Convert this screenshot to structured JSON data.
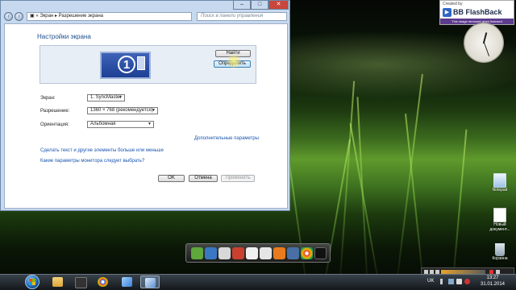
{
  "window": {
    "title": "",
    "breadcrumb_parts": [
      "Экран",
      "Разрешение экрана"
    ],
    "search_placeholder": "Поиск в панели управления",
    "page_title": "Настройки экрана",
    "buttons": {
      "find": "Найти",
      "identify": "Определить",
      "ok": "OK",
      "cancel": "Отмена",
      "apply": "Применить"
    },
    "monitor_number": "1",
    "fields": {
      "display_label": "Экран:",
      "display_value": "1. SyncMaster",
      "resolution_label": "Разрешение:",
      "resolution_value": "1360 × 768 (рекомендуется)",
      "orientation_label": "Ориентация:",
      "orientation_value": "Альбомная"
    },
    "advanced_link": "Дополнительные параметры",
    "links": [
      "Сделать текст и другие элементы больше или меньше",
      "Какие параметры монитора следует выбрать?"
    ]
  },
  "watermark": {
    "created_by": "Created by",
    "brand": "BB FlashBack",
    "note": "This image removed when licensed"
  },
  "desktop_icons": [
    {
      "label": "Notepad"
    },
    {
      "label": "Новый документ..."
    },
    {
      "label": "Корзина"
    }
  ],
  "taskbar": {
    "language": "UK",
    "time": "13:27",
    "date": "31.01.2014"
  },
  "colors": {
    "title_blue": "#1e4f8c",
    "link_blue": "#1a55b0",
    "window_frame": "#c7d9ee",
    "monitor_blue": "#2b4fa8",
    "watermark_purple": "#5c3c8c"
  }
}
